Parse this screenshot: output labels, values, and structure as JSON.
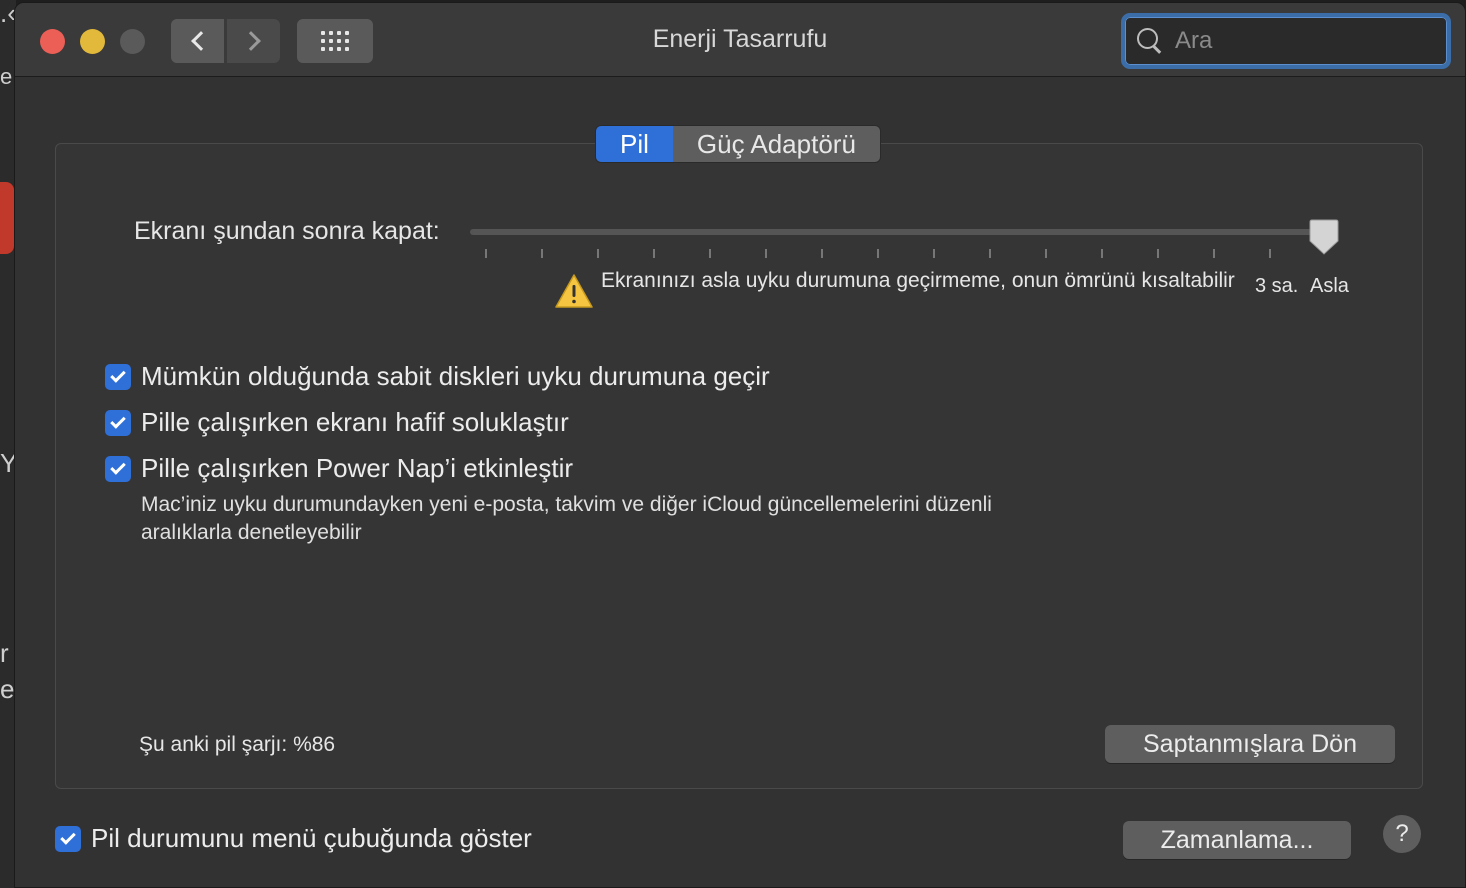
{
  "window": {
    "title": "Enerji Tasarrufu"
  },
  "search": {
    "placeholder": "Ara"
  },
  "tabs": [
    {
      "label": "Pil",
      "active": true
    },
    {
      "label": "Güç Adaptörü",
      "active": false
    }
  ],
  "display_sleep": {
    "label": "Ekranı şundan sonra kapat:",
    "value": "Asla",
    "end_labels": [
      "3 sa.",
      "Asla"
    ],
    "warning": "Ekranınızı asla uyku durumuna geçirmeme, onun ömrünü kısaltabilir"
  },
  "options": [
    {
      "label": "Mümkün olduğunda sabit diskleri uyku durumuna geçir",
      "checked": true
    },
    {
      "label": "Pille çalışırken ekranı hafif soluklaştır",
      "checked": true
    },
    {
      "label": "Pille çalışırken Power Nap’i etkinleştir",
      "checked": true
    }
  ],
  "power_nap_description": "Mac’iniz uyku durumundayken yeni e-posta, takvim ve diğer iCloud güncellemelerini düzenli aralıklarla denetleyebilir",
  "battery_status": "Şu anki pil şarjı: %86",
  "buttons": {
    "restore_defaults": "Saptanmışlara Dön",
    "schedule": "Zamanlama...",
    "help": "?"
  },
  "show_in_menubar": {
    "label": "Pil durumunu menü çubuğunda göster",
    "checked": true
  },
  "colors": {
    "accent": "#2f6fd8",
    "background": "#323232"
  }
}
